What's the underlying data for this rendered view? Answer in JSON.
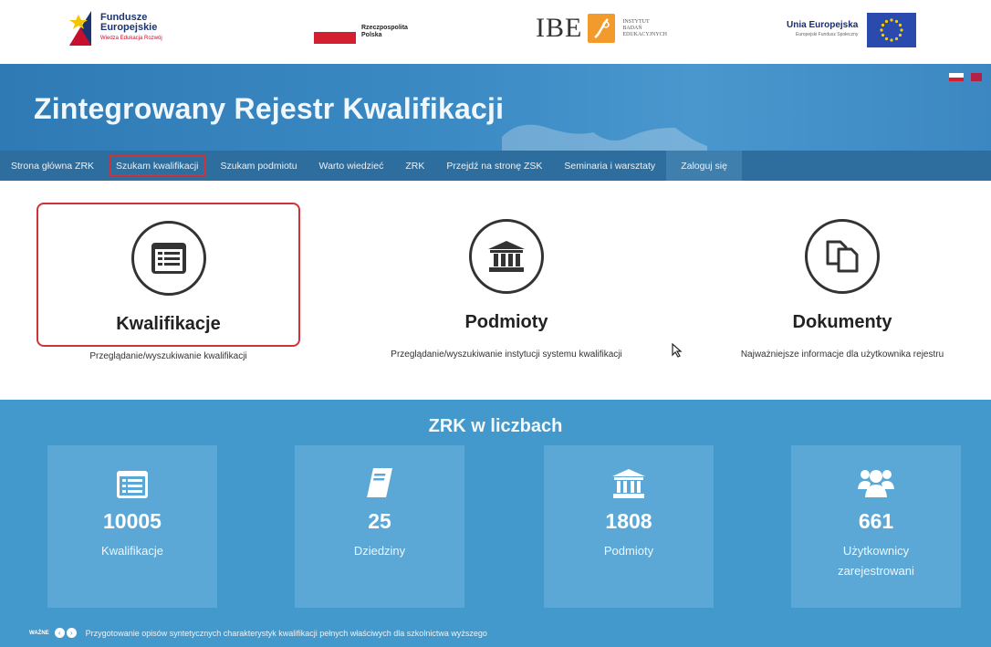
{
  "logos": {
    "fe": {
      "line1": "Fundusze",
      "line2": "Europejskie",
      "line3": "Wiedza Edukacja Rozwój"
    },
    "rp": {
      "line1": "Rzeczpospolita",
      "line2": "Polska"
    },
    "ibe": {
      "letters": "IBE",
      "sub1": "INSTYTUT",
      "sub2": "BADAŃ",
      "sub3": "EDUKACYJNYCH"
    },
    "ue": {
      "line1": "Unia Europejska",
      "line2": "Europejski Fundusz Społeczny"
    }
  },
  "banner": {
    "title": "Zintegrowany Rejestr Kwalifikacji"
  },
  "nav": {
    "items": [
      "Strona główna ZRK",
      "Szukam kwalifikacji",
      "Szukam podmiotu",
      "Warto wiedzieć",
      "ZRK",
      "Przejdź na stronę ZSK",
      "Seminaria i warsztaty",
      "Zaloguj się"
    ]
  },
  "categories": [
    {
      "title": "Kwalifikacje",
      "desc": "Przeglądanie/wyszukiwanie kwalifikacji",
      "icon": "list-icon"
    },
    {
      "title": "Podmioty",
      "desc": "Przeglądanie/wyszukiwanie instytucji systemu kwalifikacji",
      "icon": "institution-icon"
    },
    {
      "title": "Dokumenty",
      "desc": "Najważniejsze informacje dla użytkownika rejestru",
      "icon": "documents-icon"
    }
  ],
  "stats": {
    "title": "ZRK w liczbach",
    "items": [
      {
        "value": "10005",
        "label": "Kwalifikacje",
        "icon": "list-icon"
      },
      {
        "value": "25",
        "label": "Dziedziny",
        "icon": "book-icon"
      },
      {
        "value": "1808",
        "label": "Podmioty",
        "icon": "institution-icon"
      },
      {
        "value": "661",
        "label": "Użytkownicy zarejestrowani",
        "icon": "users-icon"
      }
    ]
  },
  "news": {
    "badge": "WAŻNE",
    "text": "Przygotowanie opisów syntetycznych charakterystyk kwalifikacji pełnych właściwych dla szkolnictwa wyższego"
  },
  "colors": {
    "banner": "#3b8ac4",
    "nav": "#2e6e9e",
    "stats": "#4499cc",
    "highlight": "#d0323a"
  }
}
